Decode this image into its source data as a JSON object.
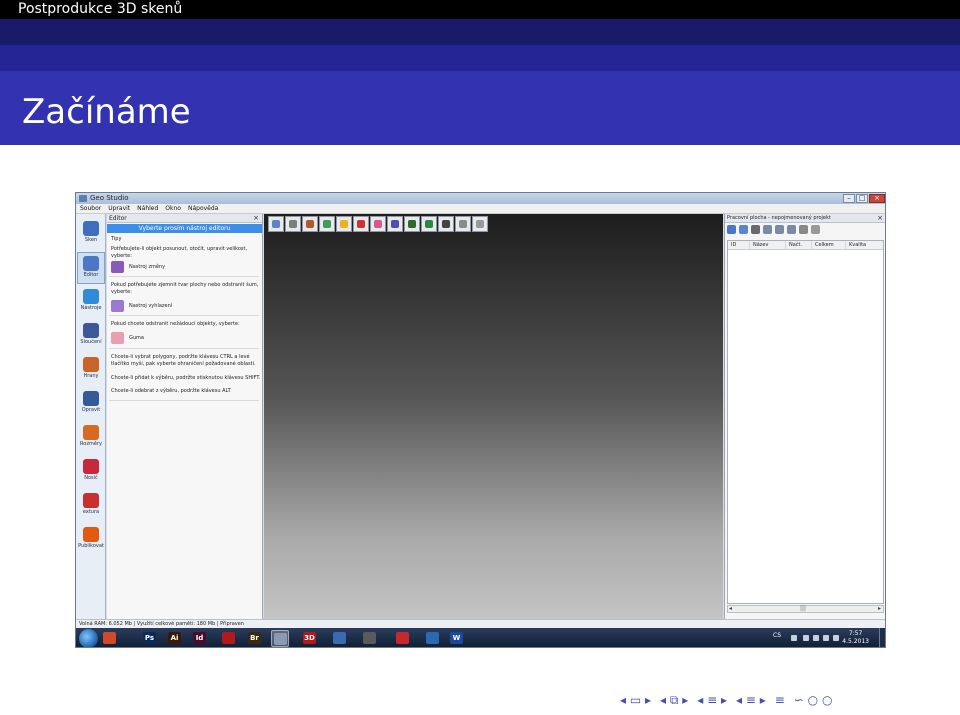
{
  "header": {
    "section_title": "Postprodukce 3D skenů",
    "frame_title": "Začínáme"
  },
  "app": {
    "window_title": "Geo Studio",
    "menu": [
      "Soubor",
      "Upravit",
      "Náhled",
      "Okno",
      "Nápověda"
    ],
    "left_tools": [
      {
        "label": "Sken",
        "icon": "scan-icon",
        "color": "#3c6fbe"
      },
      {
        "label": "Editor",
        "icon": "editor-icon",
        "color": "#4a78c6"
      },
      {
        "label": "Nástroje",
        "icon": "tools-icon",
        "color": "#2f8ad8"
      },
      {
        "label": "Sloučení",
        "icon": "merge-icon",
        "color": "#3b5998"
      },
      {
        "label": "Hrany",
        "icon": "edges-icon",
        "color": "#c86428"
      },
      {
        "label": "Opravit",
        "icon": "repair-icon",
        "color": "#355a9a"
      },
      {
        "label": "Rozměry",
        "icon": "measure-icon",
        "color": "#d76a22"
      },
      {
        "label": "Nosič",
        "icon": "carrier-icon",
        "color": "#c8283c"
      },
      {
        "label": "extura",
        "icon": "texture-icon",
        "color": "#c83030"
      },
      {
        "label": "Publikovat",
        "icon": "publish-icon",
        "color": "#e05a12"
      }
    ],
    "editor_panel": {
      "title": "Editor",
      "selected": "Vyberte prosím nástroj editoru",
      "tips_label": "Tipy",
      "tip1": "Potřebujete-li objekt posunout, otočit, upravit velikost, vyberte:",
      "btn1": "Nastroj změny",
      "tip2": "Pokud potřebujete zjemnit tvar plochy nebo odstranit šum, vyberte:",
      "btn2": "Nastroj vyhlazení",
      "tip3": "Pokud chcete odstranit nežádoucí objekty, vyberte:",
      "btn3": "Guma",
      "tip4": "Chcete-li vybrat polygony, podržte klávesu CTRL a levé tlačítko myši, pak vyberte ohraničení požadované oblasti.",
      "tip5": "Chcete-li přidat k výběru, podržte stisknutou klávesu SHIFT.",
      "tip6": "Chcete-li odebrat z výběru, podržte klávesu ALT"
    },
    "viewport_tools": [
      {
        "icon": "cube-view-icon",
        "color": "#5a86c8"
      },
      {
        "icon": "axes-icon",
        "color": "#7c7c7c"
      },
      {
        "icon": "grid-icon",
        "color": "#b45a2a"
      },
      {
        "icon": "color-cube-icon",
        "color": "#3aa05a"
      },
      {
        "icon": "light-icon",
        "color": "#e6b422"
      },
      {
        "icon": "red-box-icon",
        "color": "#cc3333"
      },
      {
        "icon": "pink-box-icon",
        "color": "#d85a8a"
      },
      {
        "icon": "sphere-icon",
        "color": "#4f4fb0"
      },
      {
        "icon": "half-moon-icon",
        "color": "#2b6b2b"
      },
      {
        "icon": "frame-icon",
        "color": "#2b8a3c"
      },
      {
        "icon": "axis-gizmo-icon",
        "color": "#444444"
      },
      {
        "icon": "box-outline-icon",
        "color": "#8a8a8a"
      },
      {
        "icon": "eraser-icon",
        "color": "#9a9a9a"
      }
    ],
    "project_panel": {
      "title": "Pracovní plocha - nepojmenovaný projekt",
      "columns": [
        "ID",
        "Název",
        "Načt.",
        "Celkem",
        "Kvalita"
      ],
      "tools": [
        {
          "icon": "open-icon",
          "color": "#4a78c6"
        },
        {
          "icon": "save-icon",
          "color": "#5a86c8"
        },
        {
          "icon": "import-icon",
          "color": "#6a6a6a"
        },
        {
          "icon": "undo-icon",
          "color": "#7a8aa4"
        },
        {
          "icon": "redo-icon",
          "color": "#7a8aa4"
        },
        {
          "icon": "refresh-icon",
          "color": "#7a8aa4"
        },
        {
          "icon": "copy-icon",
          "color": "#888888"
        },
        {
          "icon": "settings-icon",
          "color": "#999999"
        }
      ]
    },
    "status": "Volná RAM: 6.052 Mb  |  Využití celkové paměti: 180 Mb  |  Připraven"
  },
  "taskbar": {
    "items": [
      {
        "icon": "chrome-icon",
        "text": "",
        "color": "#d04a2a"
      },
      {
        "icon": "photoshop-icon",
        "text": "Ps",
        "color": "#0a2a5a"
      },
      {
        "icon": "illustrator-icon",
        "text": "Ai",
        "color": "#3a1a06"
      },
      {
        "icon": "indesign-icon",
        "text": "Id",
        "color": "#4a0a2a"
      },
      {
        "icon": "acrobat-icon",
        "text": "",
        "color": "#b01a1a"
      },
      {
        "icon": "bridge-icon",
        "text": "Br",
        "color": "#3a2a08"
      },
      {
        "icon": "studio-icon",
        "text": "",
        "color": "#8a9ab0"
      },
      {
        "icon": "3d-app-icon",
        "text": "3D",
        "color": "#b01a1a"
      },
      {
        "icon": "molecule-icon",
        "text": "",
        "color": "#3a6ab0"
      },
      {
        "icon": "cinema-icon",
        "text": "",
        "color": "#5a5a5a"
      },
      {
        "icon": "sketchup-icon",
        "text": "",
        "color": "#c8282c"
      },
      {
        "icon": "scanner-icon",
        "text": "",
        "color": "#2a6ab0"
      },
      {
        "icon": "word-icon",
        "text": "W",
        "color": "#1a4aa0"
      }
    ],
    "lang": "CS",
    "time": "7:57",
    "date": "4.5.2013"
  },
  "nav": {
    "symbols": [
      "◂ ▭ ▸",
      "◂ ⧉ ▸",
      "◂ ≡ ▸",
      "◂ ≡ ▸",
      "≡",
      "∽ ○ ○"
    ]
  }
}
